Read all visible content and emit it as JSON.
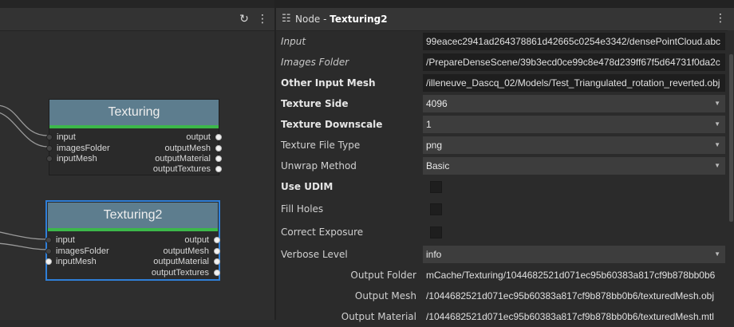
{
  "graph": {
    "toolbar": {
      "refresh_icon": "refresh-icon",
      "menu_icon": "more-vert-icon"
    },
    "nodes": [
      {
        "title": "Texturing",
        "selected": false,
        "inputs": [
          "input",
          "imagesFolder",
          "inputMesh"
        ],
        "outputs": [
          "output",
          "outputMesh",
          "outputMaterial",
          "outputTextures"
        ]
      },
      {
        "title": "Texturing2",
        "selected": true,
        "inputs": [
          "input",
          "imagesFolder",
          "inputMesh"
        ],
        "outputs": [
          "output",
          "outputMesh",
          "outputMaterial",
          "outputTextures"
        ]
      }
    ]
  },
  "attributes": {
    "header_prefix": "Node - ",
    "node_name": "Texturing2",
    "rows": [
      {
        "label": "Input",
        "value": "99eacec2941ad264378861d42665c0254e3342/densePointCloud.abc"
      },
      {
        "label": "Images Folder",
        "value": "/PrepareDenseScene/39b3ecd0ce99c8e478d239ff67f5d64731f0da2c"
      },
      {
        "label": "Other Input Mesh",
        "value": "/illeneuve_Dascq_02/Models/Test_Triangulated_rotation_reverted.obj"
      },
      {
        "label": "Texture Side",
        "value": "4096"
      },
      {
        "label": "Texture Downscale",
        "value": "1"
      },
      {
        "label": "Texture File Type",
        "value": "png"
      },
      {
        "label": "Unwrap Method",
        "value": "Basic"
      },
      {
        "label": "Use UDIM",
        "value": ""
      },
      {
        "label": "Fill Holes",
        "value": ""
      },
      {
        "label": "Correct Exposure",
        "value": ""
      },
      {
        "label": "Verbose Level",
        "value": "info"
      },
      {
        "label": "Output Folder",
        "value": "mCache/Texturing/1044682521d071ec95b60383a817cf9b878bb0b6"
      },
      {
        "label": "Output Mesh",
        "value": "/1044682521d071ec95b60383a817cf9b878bb0b6/texturedMesh.obj"
      },
      {
        "label": "Output Material",
        "value": "/1044682521d071ec95b60383a817cf9b878bb0b6/texturedMesh.mtl"
      }
    ]
  },
  "colors": {
    "accent": "#2f7fd8",
    "node_header": "#5d7d8e",
    "status_bar": "#3cb84a"
  }
}
